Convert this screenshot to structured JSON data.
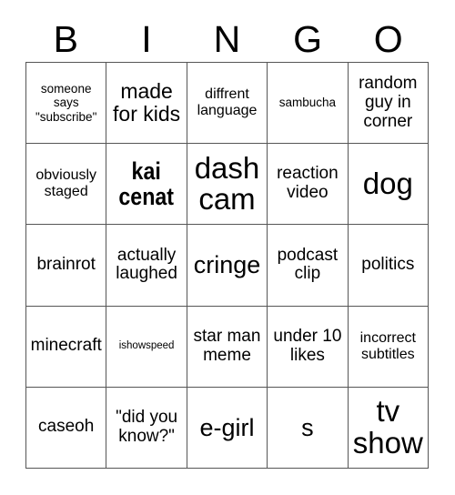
{
  "card": {
    "header_letters": [
      "B",
      "I",
      "N",
      "G",
      "O"
    ],
    "border_color": "#565656",
    "background_color": "#ffffff",
    "text_color": "#000000",
    "rows": 5,
    "columns": 5,
    "cells": [
      [
        {
          "text": "someone says \"subscribe\"",
          "size": "xs",
          "bold": false
        },
        {
          "text": "made for kids",
          "size": "l",
          "bold": false
        },
        {
          "text": "diffrent language",
          "size": "s",
          "bold": false
        },
        {
          "text": "sambucha",
          "size": "xs",
          "bold": false
        },
        {
          "text": "random guy in corner",
          "size": "m",
          "bold": false
        }
      ],
      [
        {
          "text": "obviously staged",
          "size": "s",
          "bold": false
        },
        {
          "text": "kai cenat",
          "size": "xl",
          "bold": true
        },
        {
          "text": "dash cam",
          "size": "xxl",
          "bold": false
        },
        {
          "text": "reaction video",
          "size": "m",
          "bold": false
        },
        {
          "text": "dog",
          "size": "xxl",
          "bold": false
        }
      ],
      [
        {
          "text": "brainrot",
          "size": "m",
          "bold": false
        },
        {
          "text": "actually laughed",
          "size": "m",
          "bold": false
        },
        {
          "text": "cringe",
          "size": "xl",
          "bold": false
        },
        {
          "text": "podcast clip",
          "size": "m",
          "bold": false
        },
        {
          "text": "politics",
          "size": "m",
          "bold": false
        }
      ],
      [
        {
          "text": "minecraft",
          "size": "m",
          "bold": false
        },
        {
          "text": "ishowspeed",
          "size": "xxs",
          "bold": false
        },
        {
          "text": "star man meme",
          "size": "m",
          "bold": false
        },
        {
          "text": "under 10 likes",
          "size": "m",
          "bold": false
        },
        {
          "text": "incorrect subtitles",
          "size": "s",
          "bold": false
        }
      ],
      [
        {
          "text": "caseoh",
          "size": "m",
          "bold": false
        },
        {
          "text": "\"did you know?\"",
          "size": "m",
          "bold": false
        },
        {
          "text": "e-girl",
          "size": "xl",
          "bold": false
        },
        {
          "text": "s",
          "size": "xl",
          "bold": false
        },
        {
          "text": "tv show",
          "size": "xxl",
          "bold": false
        }
      ]
    ]
  }
}
